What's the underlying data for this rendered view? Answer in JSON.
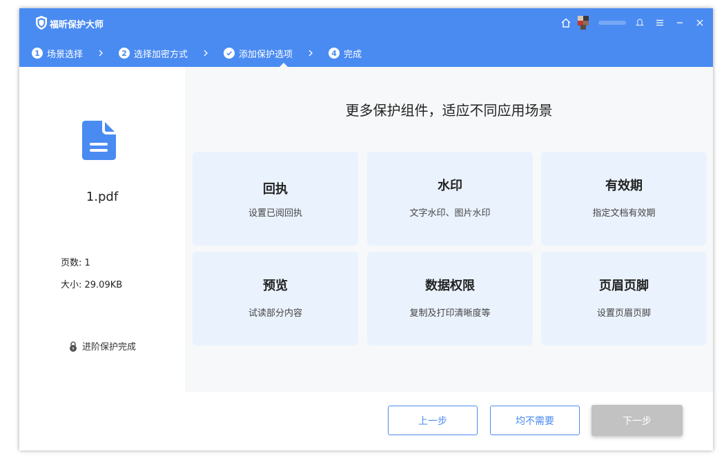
{
  "app": {
    "title": "福昕保护大师"
  },
  "steps": [
    {
      "num": "1",
      "label": "场景选择",
      "state": "done"
    },
    {
      "num": "2",
      "label": "选择加密方式",
      "state": "done"
    },
    {
      "num": "",
      "label": "添加保护选项",
      "state": "current"
    },
    {
      "num": "4",
      "label": "完成",
      "state": "pending"
    }
  ],
  "sidebar": {
    "file_name": "1.pdf",
    "pages_label": "页数: 1",
    "size_label": "大小: 29.09KB",
    "status": "进阶保护完成"
  },
  "main": {
    "heading": "更多保护组件，适应不同应用场景",
    "cards": [
      {
        "title": "回执",
        "desc": "设置已阅回执"
      },
      {
        "title": "水印",
        "desc": "文字水印、图片水印"
      },
      {
        "title": "有效期",
        "desc": "指定文档有效期"
      },
      {
        "title": "预览",
        "desc": "试读部分内容"
      },
      {
        "title": "数据权限",
        "desc": "复制及打印清晰度等"
      },
      {
        "title": "页眉页脚",
        "desc": "设置页眉页脚"
      }
    ]
  },
  "footer": {
    "prev": "上一步",
    "none": "均不需要",
    "next": "下一步"
  },
  "colors": {
    "accent": "#4a8bf2",
    "card_bg": "#eaf2fd",
    "disabled": "#c2c2c2"
  },
  "icons": [
    "shield-logo-icon",
    "home-icon",
    "avatar",
    "bell-icon",
    "menu-icon",
    "minimize-icon",
    "close-icon",
    "chevron-right-icon",
    "check-icon",
    "document-icon",
    "lock-icon"
  ]
}
